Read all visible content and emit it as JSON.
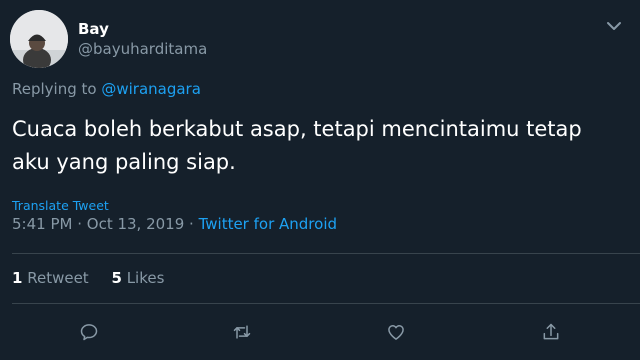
{
  "user": {
    "display_name": "Bay",
    "handle": "@bayuharditama"
  },
  "reply": {
    "prefix": "Replying to ",
    "mention": "@wiranagara"
  },
  "tweet": {
    "text": "Cuaca boleh berkabut asap, tetapi mencintaimu tetap aku yang paling siap.",
    "translate_label": "Translate Tweet",
    "time": "5:41 PM",
    "separator": " · ",
    "date": "Oct 13, 2019",
    "source": "Twitter for Android"
  },
  "stats": {
    "retweets_count": "1",
    "retweets_label": "Retweet",
    "likes_count": "5",
    "likes_label": "Likes"
  },
  "actions": [
    "reply-icon",
    "retweet-icon",
    "like-icon",
    "share-icon"
  ],
  "colors": {
    "background": "#15202b",
    "accent": "#1da1f2",
    "muted": "#8899a6",
    "divider": "#38444d"
  }
}
